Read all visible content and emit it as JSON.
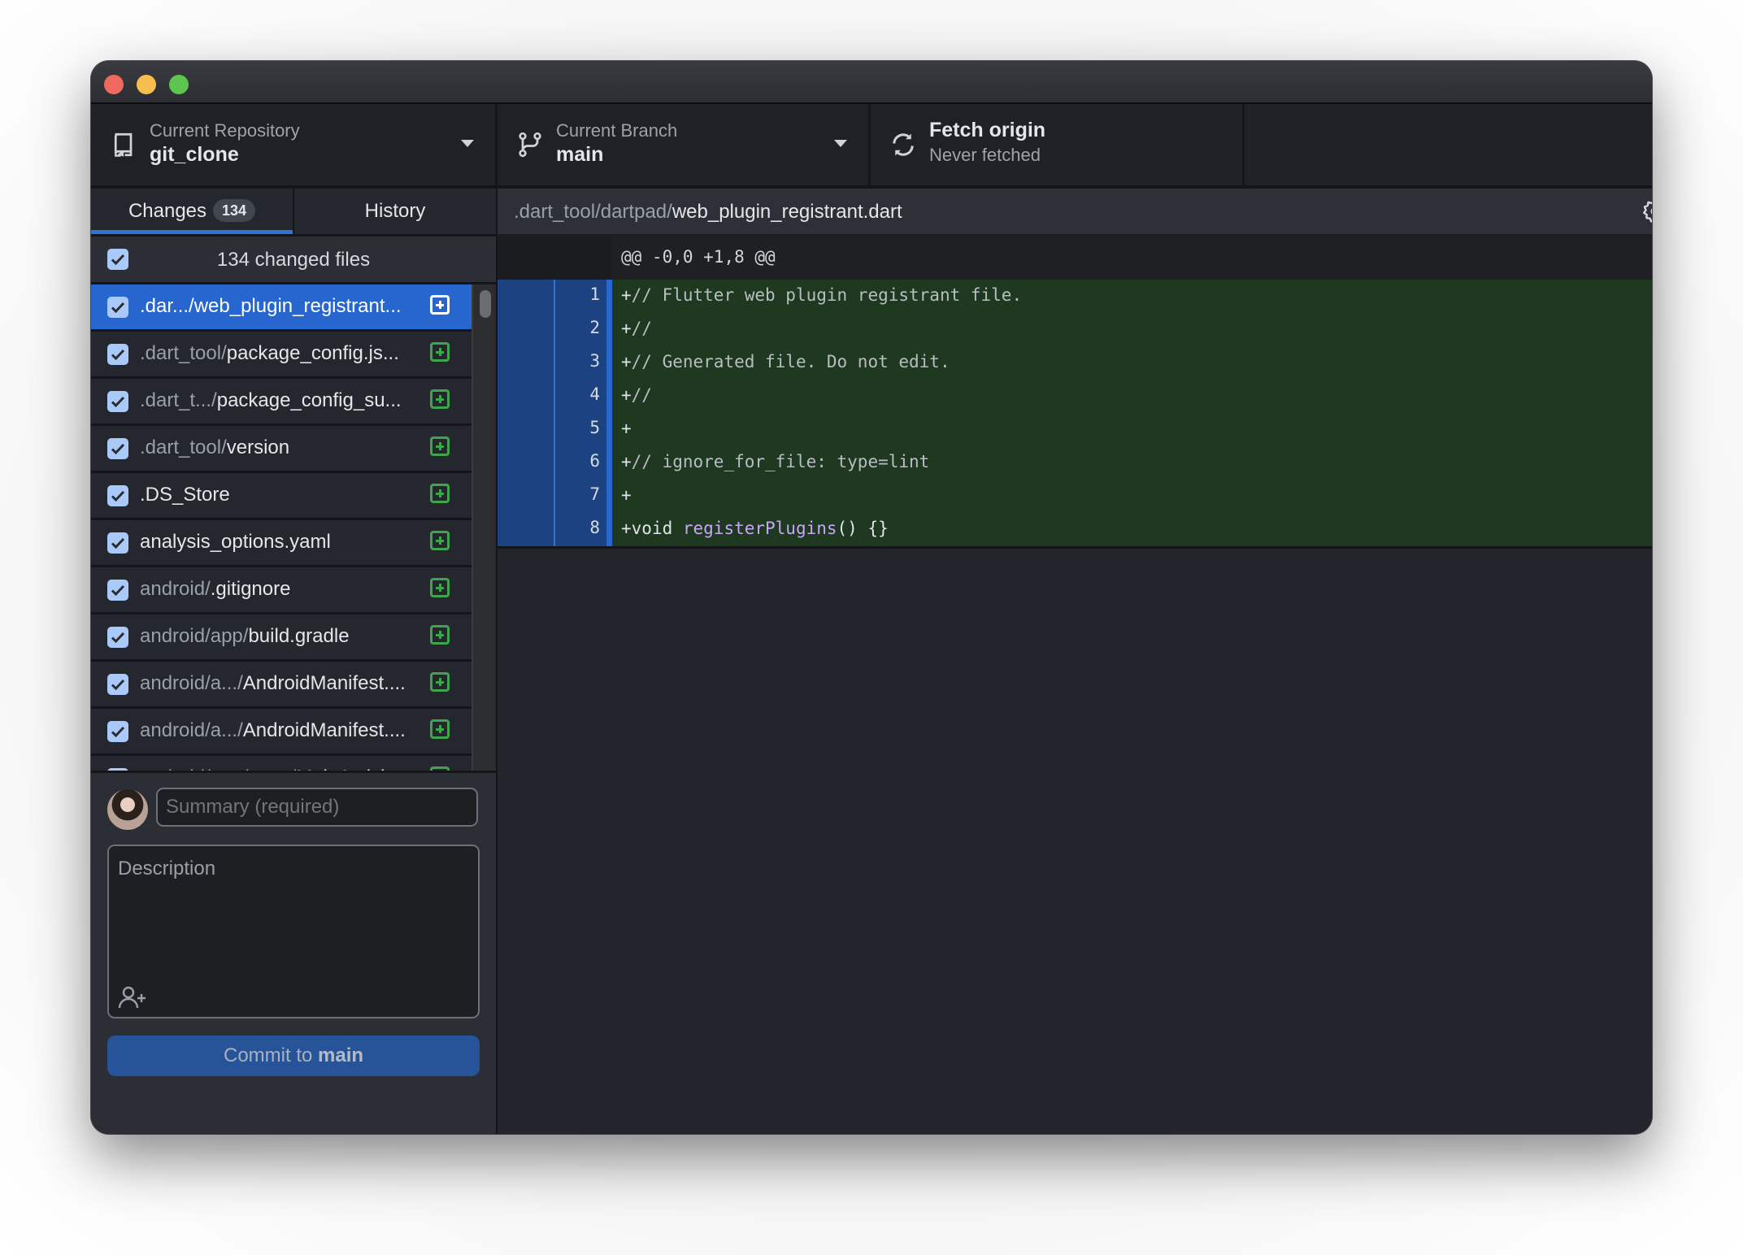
{
  "window": {
    "controls": [
      "close",
      "minimize",
      "zoom"
    ]
  },
  "toolbar": {
    "repository": {
      "label": "Current Repository",
      "value": "git_clone",
      "icon": "repo-icon"
    },
    "branch": {
      "label": "Current Branch",
      "value": "main",
      "icon": "git-branch-icon"
    },
    "fetch": {
      "label": "Fetch origin",
      "value": "Never fetched",
      "icon": "sync-icon"
    }
  },
  "sidebar": {
    "tabs": [
      {
        "label": "Changes",
        "badge": "134",
        "active": true
      },
      {
        "label": "History",
        "active": false
      }
    ],
    "changed_files_label": "134 changed files",
    "files": [
      {
        "dir": ".dar.../",
        "name": "web_plugin_registrant...",
        "checked": true,
        "selected": true,
        "status": "added"
      },
      {
        "dir": ".dart_tool/",
        "name": "package_config.js...",
        "checked": true,
        "selected": false,
        "status": "added"
      },
      {
        "dir": ".dart_t.../",
        "name": "package_config_su...",
        "checked": true,
        "selected": false,
        "status": "added"
      },
      {
        "dir": ".dart_tool/",
        "name": "version",
        "checked": true,
        "selected": false,
        "status": "added"
      },
      {
        "dir": "",
        "name": ".DS_Store",
        "checked": true,
        "selected": false,
        "status": "added"
      },
      {
        "dir": "",
        "name": "analysis_options.yaml",
        "checked": true,
        "selected": false,
        "status": "added"
      },
      {
        "dir": "android/",
        "name": ".gitignore",
        "checked": true,
        "selected": false,
        "status": "added"
      },
      {
        "dir": "android/app/",
        "name": "build.gradle",
        "checked": true,
        "selected": false,
        "status": "added"
      },
      {
        "dir": "android/a.../",
        "name": "AndroidManifest....",
        "checked": true,
        "selected": false,
        "status": "added"
      },
      {
        "dir": "android/a.../",
        "name": "AndroidManifest....",
        "checked": true,
        "selected": false,
        "status": "added"
      },
      {
        "dir": "android/app/src.../",
        "name": "MainActivi...",
        "checked": true,
        "selected": false,
        "status": "added"
      }
    ],
    "commit": {
      "summary_placeholder": "Summary (required)",
      "description_placeholder": "Description",
      "button_prefix": "Commit to ",
      "button_branch": "main"
    }
  },
  "diff": {
    "path_dir": ".dart_tool/dartpad/",
    "path_file": "web_plugin_registrant.dart",
    "hunk_header": "@@ -0,0 +1,8 @@",
    "lines": [
      {
        "num": "1",
        "prefix": "+",
        "comment": "// Flutter web plugin registrant file.",
        "code": "",
        "fn": "",
        "rest": ""
      },
      {
        "num": "2",
        "prefix": "+",
        "comment": "//",
        "code": "",
        "fn": "",
        "rest": ""
      },
      {
        "num": "3",
        "prefix": "+",
        "comment": "// Generated file. Do not edit.",
        "code": "",
        "fn": "",
        "rest": ""
      },
      {
        "num": "4",
        "prefix": "+",
        "comment": "//",
        "code": "",
        "fn": "",
        "rest": ""
      },
      {
        "num": "5",
        "prefix": "+",
        "comment": "",
        "code": "",
        "fn": "",
        "rest": ""
      },
      {
        "num": "6",
        "prefix": "+",
        "comment": "// ignore_for_file: type=lint",
        "code": "",
        "fn": "",
        "rest": ""
      },
      {
        "num": "7",
        "prefix": "+",
        "comment": "",
        "code": "",
        "fn": "",
        "rest": ""
      },
      {
        "num": "8",
        "prefix": "+",
        "comment": "",
        "code": "void ",
        "fn": "registerPlugins",
        "rest": "() {}"
      }
    ]
  },
  "colors": {
    "accent_blue": "#2766cf",
    "added_green": "#3fa54a",
    "diff_added_bg": "#1e391f",
    "commit_button": "#275499"
  }
}
